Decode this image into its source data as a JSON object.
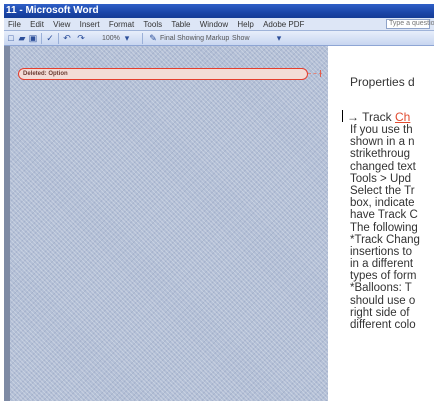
{
  "window": {
    "title": "11 - Microsoft Word"
  },
  "menu": {
    "items": [
      "File",
      "Edit",
      "View",
      "Insert",
      "Format",
      "Tools",
      "Table",
      "Window",
      "Help",
      "Adobe PDF"
    ],
    "ask": "Type a question"
  },
  "toolbar": {
    "zoom": "100%",
    "display": "Final Showing Markup",
    "show": "Show"
  },
  "comment": {
    "label": "Deleted: Option"
  },
  "page": {
    "heading": "Properties d",
    "track_prefix": "→ Track ",
    "track_red": "Ch",
    "lines": [
      "If you use th",
      "shown in a n",
      "strikethroug",
      "changed text",
      "Tools > Upd",
      "Select the Tr",
      "box, indicate",
      "have Track C",
      "The following",
      "*Track Chang",
      "insertions to",
      "in a different",
      "types of form",
      "*Balloons: T",
      "should use o",
      "right side of",
      "different colo"
    ]
  }
}
